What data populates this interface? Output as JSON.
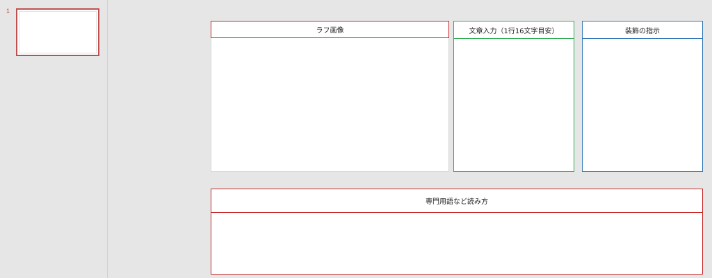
{
  "thumbnails": {
    "items": [
      {
        "number": "1"
      }
    ]
  },
  "panels": {
    "rough_image": {
      "label": "ラフ画像"
    },
    "text_input": {
      "label": "文章入力（1行16文字目安）"
    },
    "decoration": {
      "label": "装飾の指示"
    },
    "terms": {
      "label": "専門用語など読み方"
    }
  },
  "colors": {
    "thumb_border": "#c0504d",
    "rough_header_border": "#c62828",
    "text_border": "#2eaa4f",
    "decoration_border": "#2e75b6",
    "terms_border": "#c62828",
    "background": "#e6e6e6"
  }
}
